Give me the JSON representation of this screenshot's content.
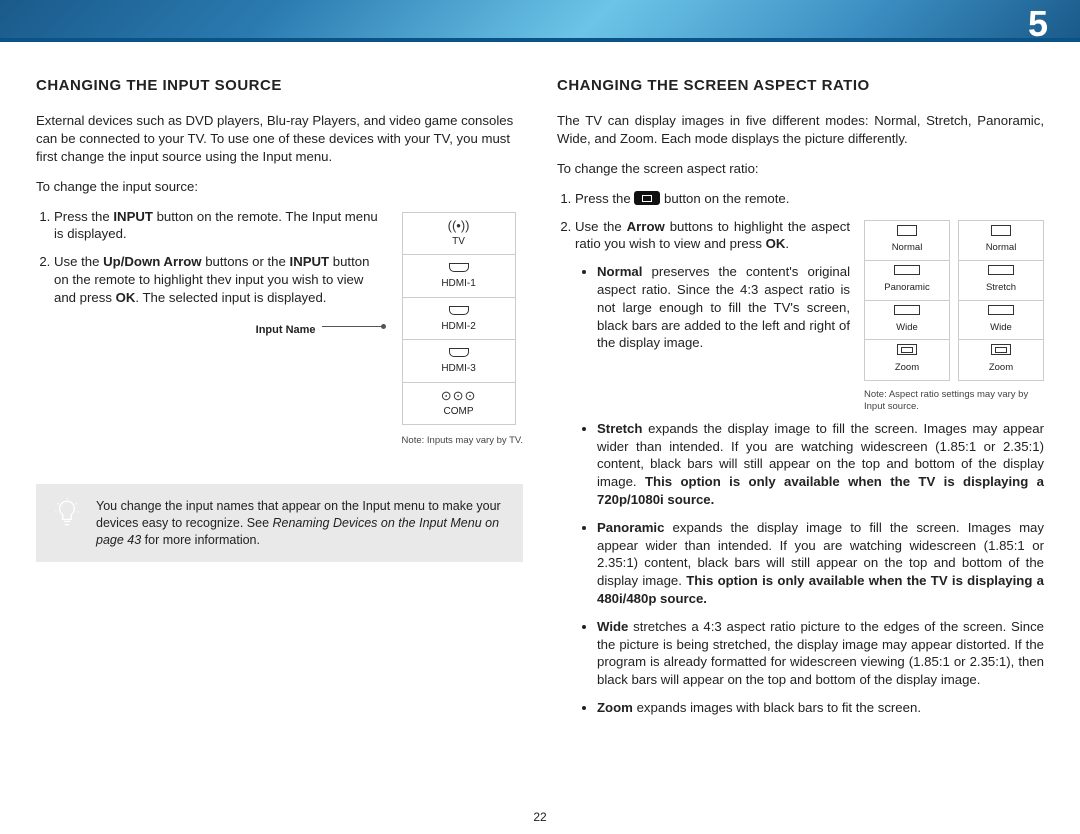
{
  "header": {
    "pageChapter": "5"
  },
  "footer": {
    "pageNumber": "22"
  },
  "left": {
    "heading": "CHANGING THE INPUT SOURCE",
    "intro": "External devices such as DVD players, Blu-ray Players, and video game consoles can be connected to your TV. To use one of these devices with your TV, you must first change the input source using the Input menu.",
    "lead": "To change the input source:",
    "step1a": "Press the ",
    "step1b": "INPUT",
    "step1c": " button on the remote. The Input menu is displayed.",
    "step2a": "Use the ",
    "step2b": "Up/Down Arrow",
    "step2c": " buttons or the ",
    "step2d": "INPUT",
    "step2e": " button on the remote to highlight thev input you wish to view and press ",
    "step2f": "OK",
    "step2g": ". The selected input is displayed.",
    "inputNameLabel": "Input Name",
    "inputNote": "Note: Inputs may vary by TV.",
    "menu": {
      "tv": "TV",
      "hdmi1": "HDMI-1",
      "hdmi2": "HDMI-2",
      "hdmi3": "HDMI-3",
      "comp": "COMP"
    },
    "tip1": "You change the input names that appear on the Input menu to make your devices easy to recognize. See ",
    "tipItalic": "Renaming Devices on the Input Menu on page 43",
    "tip2": " for more information."
  },
  "right": {
    "heading": "CHANGING THE SCREEN ASPECT RATIO",
    "intro": "The TV can display images in five different modes: Normal, Stretch, Panoramic, Wide, and Zoom. Each mode displays the picture differently.",
    "lead": "To change the screen aspect ratio:",
    "step1a": "Press the ",
    "step1b": " button on the remote.",
    "step2a": "Use the ",
    "step2b": "Arrow",
    "step2c": " buttons to highlight the aspect ratio you wish to view and press ",
    "step2d": "OK",
    "step2e": ".",
    "modes": {
      "normal": {
        "name": "Normal",
        "desc": " preserves the content's original aspect ratio. Since the 4:3 aspect ratio is not large enough to fill the TV's screen, black bars are added to the left and right of the display image."
      },
      "stretch": {
        "name": "Stretch",
        "desc": " expands the display image to fill the screen. Images may appear wider than intended. If you are watching widescreen (1.85:1 or 2.35:1) content, black bars will still appear on the top and bottom of the display image. ",
        "bold": "This option is only available when the TV is displaying a 720p/1080i source."
      },
      "panoramic": {
        "name": "Panoramic",
        "desc": " expands the display image to fill the screen. Images may appear wider than intended. If you are watching widescreen (1.85:1 or 2.35:1) content, black bars will still appear on the top and bottom of the display image. ",
        "bold": "This option is only available when the TV is displaying a 480i/480p source."
      },
      "wide": {
        "name": "Wide",
        "desc": " stretches a 4:3 aspect ratio picture to the edges of the screen. Since the picture is being stretched, the display image may appear distorted. If the program is already formatted for widescreen viewing (1.85:1 or 2.35:1), then black bars will appear on the top and bottom of the display image."
      },
      "zoom": {
        "name": "Zoom",
        "desc": " expands images with black bars to fit the screen."
      }
    },
    "panel1": {
      "r1": "Normal",
      "r2": "Panoramic",
      "r3": "Wide",
      "r4": "Zoom"
    },
    "panel2": {
      "r1": "Normal",
      "r2": "Stretch",
      "r3": "Wide",
      "r4": "Zoom"
    },
    "aspectNote": "Note: Aspect ratio settings may vary by Input source."
  }
}
